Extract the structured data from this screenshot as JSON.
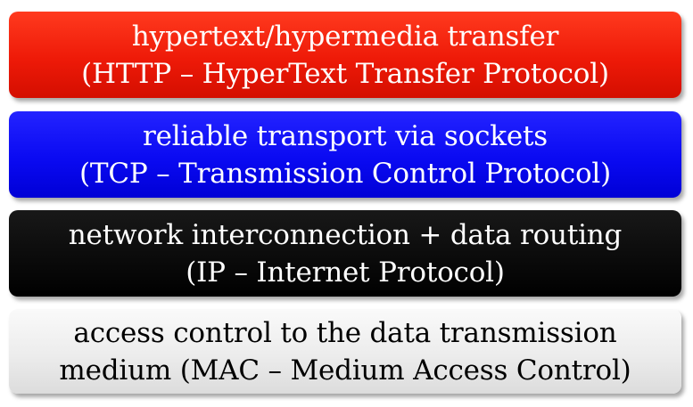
{
  "layers": [
    {
      "line1": "hypertext/hypermedia transfer",
      "line2": "(HTTP – HyperText Transfer Protocol)",
      "color": "#e8170a"
    },
    {
      "line1": "reliable transport via sockets",
      "line2": "(TCP – Transmission Control Protocol)",
      "color": "#0808f0"
    },
    {
      "line1": "network interconnection + data routing",
      "line2": "(IP – Internet Protocol)",
      "color": "#000000"
    },
    {
      "line1": "access control to the data transmission",
      "line2": "medium (MAC – Medium Access Control)",
      "color": "#eeeeee"
    }
  ]
}
